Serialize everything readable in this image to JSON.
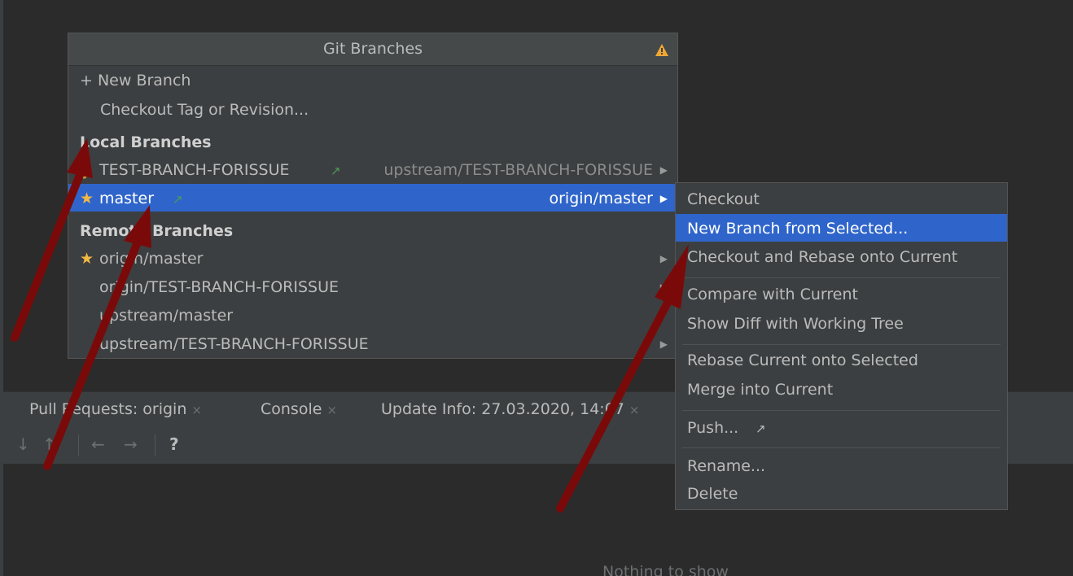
{
  "popup": {
    "title": "Git Branches",
    "new_branch": "+ New Branch",
    "checkout_tag": "Checkout Tag or Revision...",
    "local_header": "Local Branches",
    "local": [
      {
        "marker": "❯",
        "name": "TEST-BRANCH-FORISSUE",
        "outgoing": "↗",
        "tracking": "upstream/TEST-BRANCH-FORISSUE",
        "submenu": "▶"
      },
      {
        "marker": "★",
        "name": "master",
        "outgoing": "↗",
        "tracking": "origin/master",
        "submenu": "▶"
      }
    ],
    "remote_header": "Remote Branches",
    "remote": [
      {
        "marker": "★",
        "name": "origin/master",
        "submenu": "▶"
      },
      {
        "marker": "",
        "name": "origin/TEST-BRANCH-FORISSUE",
        "submenu": "▶"
      },
      {
        "marker": "",
        "name": "upstream/master",
        "submenu": ""
      },
      {
        "marker": "",
        "name": "upstream/TEST-BRANCH-FORISSUE",
        "submenu": "▶"
      }
    ]
  },
  "submenu": {
    "items": [
      "Checkout",
      "New Branch from Selected...",
      "Checkout and Rebase onto Current",
      "Compare with Current",
      "Show Diff with Working Tree",
      "Rebase Current onto Selected",
      "Merge into Current",
      "Push...",
      "Rename...",
      "Delete"
    ],
    "push_icon": "↗"
  },
  "tool_window": {
    "tabs": [
      "Pull Requests: origin",
      "Console",
      "Update Info: 27.03.2020, 14:07"
    ],
    "close_glyph": "×",
    "toolbar": {
      "down": "↓",
      "up": "↑",
      "back": "←",
      "forward": "→",
      "help": "?"
    },
    "empty_text": "Nothing to show"
  },
  "colors": {
    "background": "#2b2b2b",
    "panel": "#3c3f41",
    "selection": "#2f65ca",
    "star": "#f2b844",
    "outgoing_arrow": "#499c54",
    "annotation_arrow": "#7a0a0a"
  }
}
